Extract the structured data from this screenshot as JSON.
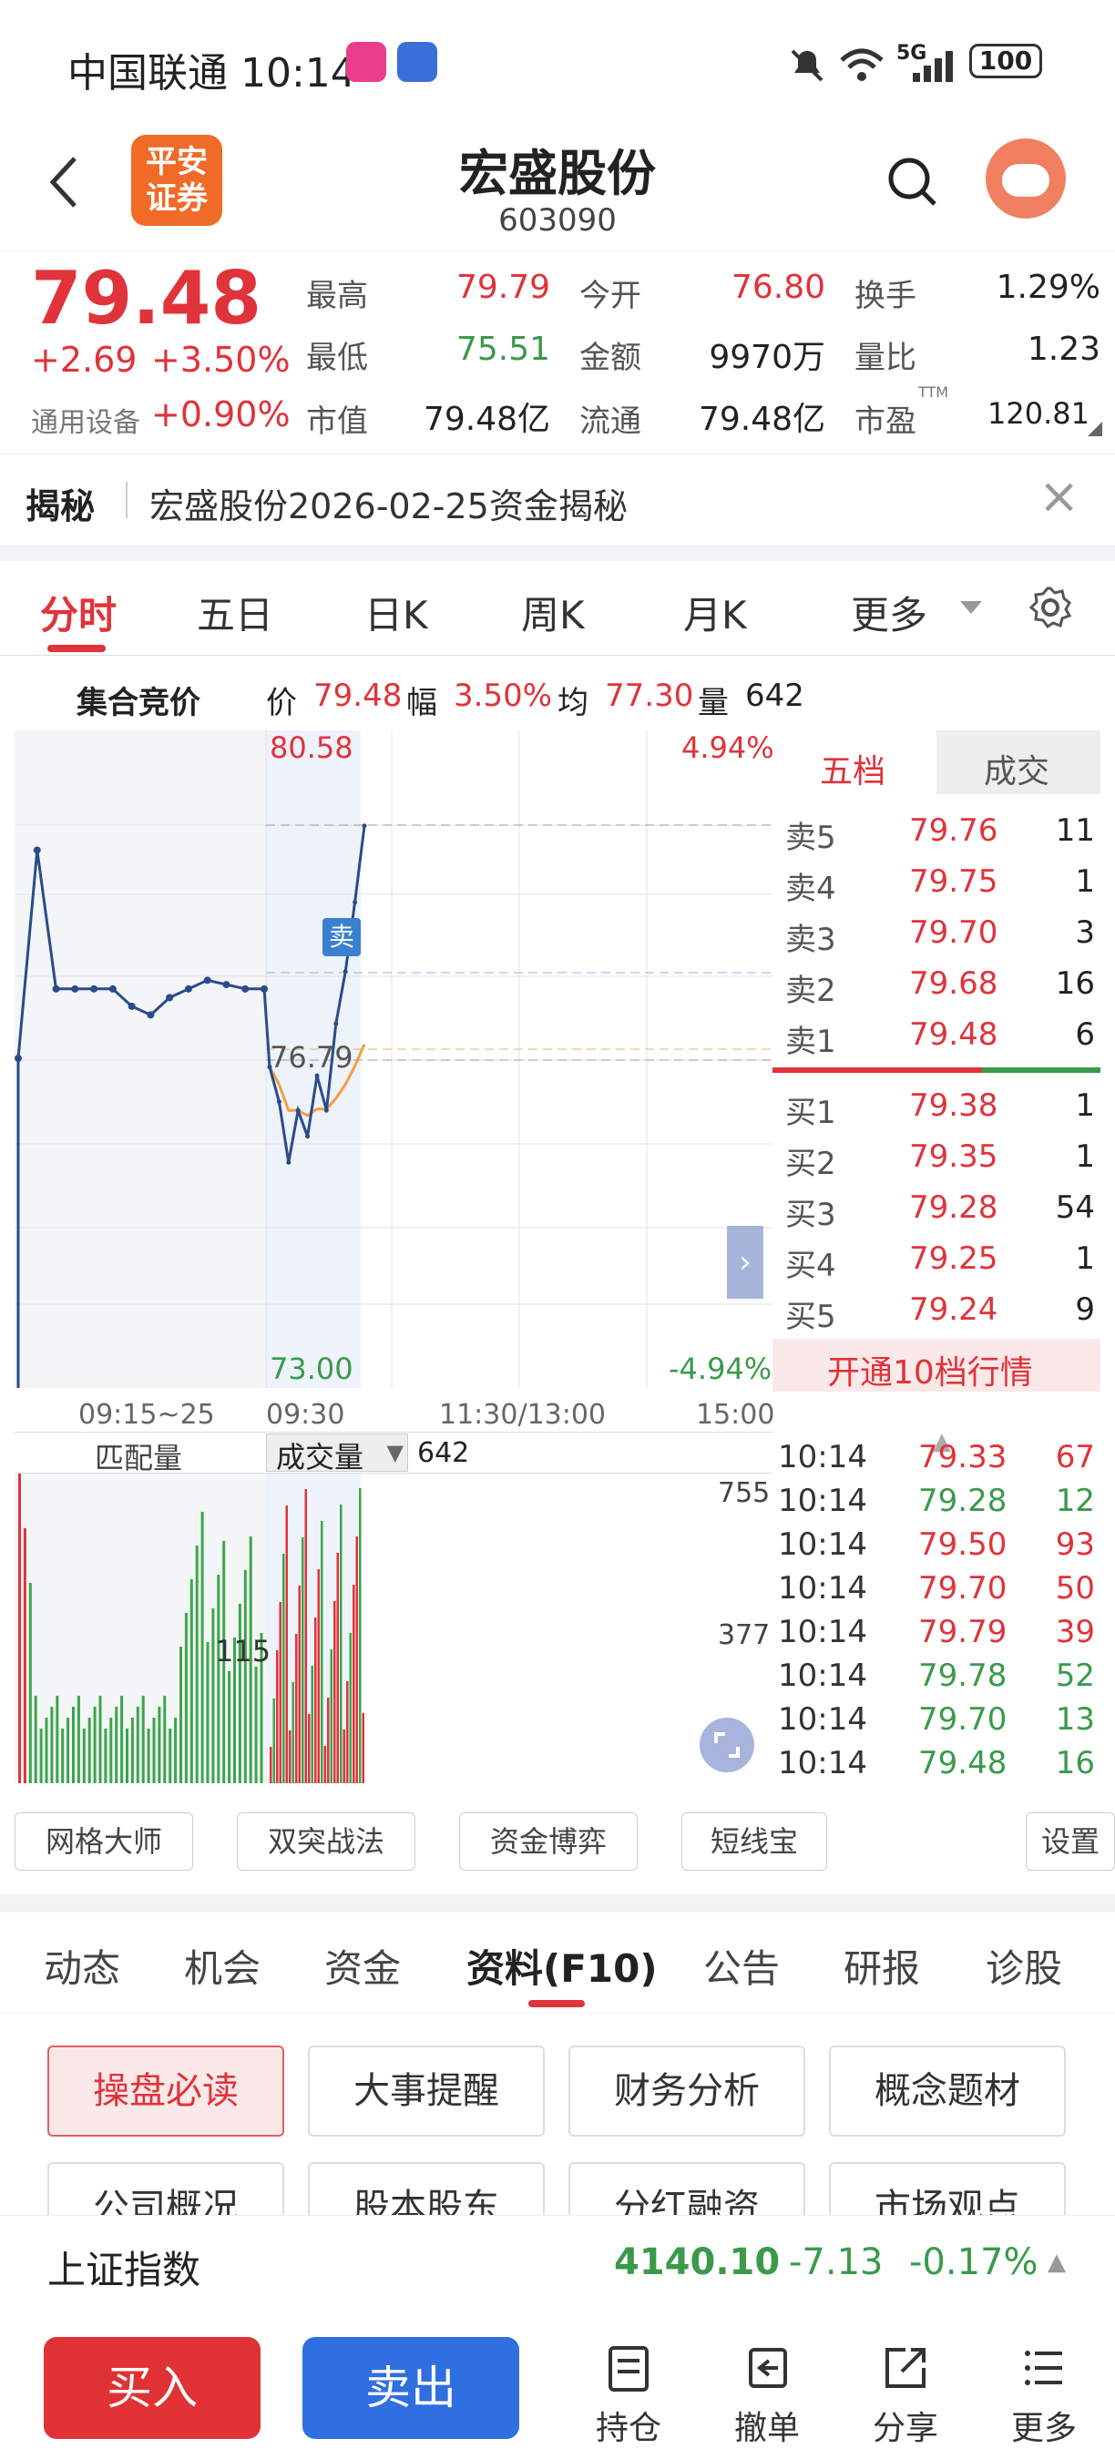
{
  "status_bar": {
    "carrier_time": "中国联通 10:14",
    "battery": "100",
    "network": "5G"
  },
  "header": {
    "back": "‹",
    "logo_line1": "平安",
    "logo_line2": "证券",
    "title": "宏盛股份",
    "code": "603090"
  },
  "quote": {
    "price": "79.48",
    "change": "+2.69",
    "change_pct": "+3.50%",
    "sector": "通用设备",
    "sector_pct": "+0.90%",
    "high_label": "最高",
    "high": "79.79",
    "open_label": "今开",
    "open": "76.80",
    "turnover_label": "换手",
    "turnover": "1.29%",
    "low_label": "最低",
    "low": "75.51",
    "amount_label": "金额",
    "amount": "9970万",
    "vol_ratio_label": "量比",
    "vol_ratio": "1.23",
    "mktcap_label": "市值",
    "mktcap": "79.48亿",
    "float_label": "流通",
    "float": "79.48亿",
    "pe_label": "市盈",
    "pe_sup": "TTM",
    "pe": "120.81"
  },
  "reveal": {
    "label": "揭秘",
    "text": "宏盛股份2026-02-25资金揭秘",
    "close": "×"
  },
  "tabs": [
    "分时",
    "五日",
    "日K",
    "周K",
    "月K",
    "更多"
  ],
  "auction": {
    "title": "集合竞价",
    "price_label": "价",
    "price": "79.48",
    "range_label": "幅",
    "range": "3.50%",
    "avg_label": "均",
    "avg": "77.30",
    "vol_label": "量",
    "vol": "642"
  },
  "chart": {
    "y_top": "80.58",
    "y_bottom": "73.00",
    "pct_top": "4.94%",
    "pct_bottom": "-4.94%",
    "mid_label": "76.79",
    "sell_marker": "卖",
    "x_labels": [
      "09:15~25",
      "09:30",
      "11:30/13:00",
      "15:00"
    ]
  },
  "chart_data": {
    "type": "line",
    "title": "",
    "series": [
      {
        "values": [
          76.8,
          79.2,
          77.6,
          77.6,
          77.6,
          77.6,
          77.4,
          77.3,
          77.5,
          77.6,
          77.7,
          77.65,
          77.6,
          77.6,
          76.7,
          76.3,
          75.6,
          76.2,
          75.9,
          76.6,
          76.2,
          77.2,
          77.8,
          78.6,
          79.48
        ]
      }
    ],
    "ylim": [
      73.0,
      80.58
    ],
    "xlabel": "",
    "ylabel": ""
  },
  "volume": {
    "left_label": "匹配量",
    "dropdown": "成交量",
    "value": "642",
    "y_top": "755",
    "y_mid": "377",
    "left_mid": "115"
  },
  "order_book": {
    "tab_five": "五档",
    "tab_trades": "成交",
    "sells": [
      {
        "name": "卖5",
        "price": "79.76",
        "vol": "11"
      },
      {
        "name": "卖4",
        "price": "79.75",
        "vol": "1"
      },
      {
        "name": "卖3",
        "price": "79.70",
        "vol": "3"
      },
      {
        "name": "卖2",
        "price": "79.68",
        "vol": "16"
      },
      {
        "name": "卖1",
        "price": "79.48",
        "vol": "6"
      }
    ],
    "buys": [
      {
        "name": "买1",
        "price": "79.38",
        "vol": "1"
      },
      {
        "name": "买2",
        "price": "79.35",
        "vol": "1"
      },
      {
        "name": "买3",
        "price": "79.28",
        "vol": "54"
      },
      {
        "name": "买4",
        "price": "79.25",
        "vol": "1"
      },
      {
        "name": "买5",
        "price": "79.24",
        "vol": "9"
      }
    ],
    "upgrade": "开通10档行情"
  },
  "trades": [
    {
      "time": "10:14",
      "price": "79.33",
      "vol": "67",
      "color": "red"
    },
    {
      "time": "10:14",
      "price": "79.28",
      "vol": "12",
      "color": "green"
    },
    {
      "time": "10:14",
      "price": "79.50",
      "vol": "93",
      "color": "red"
    },
    {
      "time": "10:14",
      "price": "79.70",
      "vol": "50",
      "color": "red"
    },
    {
      "time": "10:14",
      "price": "79.79",
      "vol": "39",
      "color": "red"
    },
    {
      "time": "10:14",
      "price": "79.78",
      "vol": "52",
      "color": "green"
    },
    {
      "time": "10:14",
      "price": "79.70",
      "vol": "13",
      "color": "green"
    },
    {
      "time": "10:14",
      "price": "79.48",
      "vol": "16",
      "color": "green"
    }
  ],
  "tools": [
    "网格大师",
    "双突战法",
    "资金博弈",
    "短线宝",
    "设置"
  ],
  "subtabs": [
    "动态",
    "机会",
    "资金",
    "资料(F10)",
    "公告",
    "研报",
    "诊股"
  ],
  "f10_buttons": [
    "操盘必读",
    "大事提醒",
    "财务分析",
    "概念题材",
    "公司概况",
    "股本股东",
    "分红融资",
    "市场观点"
  ],
  "index_bar": {
    "name": "上证指数",
    "value": "4140.10",
    "change": "-7.13",
    "pct": "-0.17%"
  },
  "bottom": {
    "buy": "买入",
    "sell": "卖出",
    "hold": "持仓",
    "cancel": "撤单",
    "share": "分享",
    "more": "更多"
  }
}
